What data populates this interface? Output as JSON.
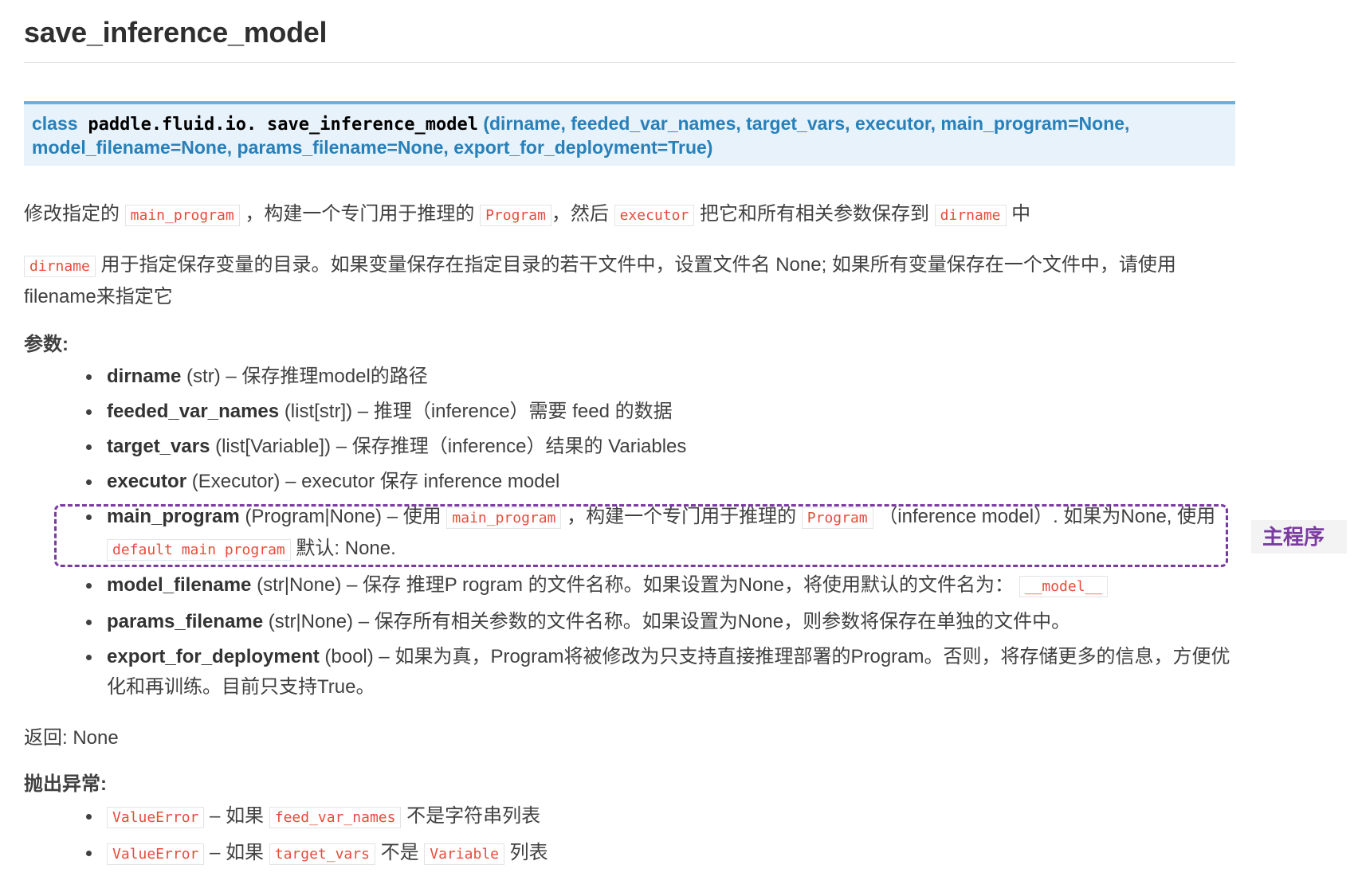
{
  "title": "save_inference_model",
  "signature": {
    "class_kw": "class",
    "module": "paddle.fluid.io.",
    "func": "save_inference_model",
    "args_line1": "(dirname, feeded_var_names, target_vars, executor, main_program=None,",
    "args_line2": "model_filename=None, params_filename=None, export_for_deployment=True)"
  },
  "desc1": {
    "t1": "修改指定的",
    "c1": "main_program",
    "t2": "，构建一个专门用于推理的",
    "c2": "Program",
    "t3": "，然后",
    "c3": "executor",
    "t4": "把它和所有相关参数保存到",
    "c4": "dirname",
    "t5": "中"
  },
  "desc2": {
    "c1": "dirname",
    "t1": "用于指定保存变量的目录。如果变量保存在指定目录的若干文件中，设置文件名 None; 如果所有变量保存在一个文件中，请使用filename来指定它"
  },
  "params_label": "参数:",
  "params": [
    {
      "name": "dirname",
      "type": "(str)",
      "sep": "–",
      "desc": "保存推理model的路径"
    },
    {
      "name": "feeded_var_names",
      "type": "(list[str])",
      "sep": "–",
      "desc": "推理（inference）需要 feed 的数据"
    },
    {
      "name": "target_vars",
      "type": "(list[Variable])",
      "sep": "–",
      "desc": "保存推理（inference）结果的 Variables"
    },
    {
      "name": "executor",
      "type": "(Executor)",
      "sep": "–",
      "desc": "executor 保存 inference model"
    },
    {
      "name": "main_program",
      "type": "(Program|None)",
      "sep": "–",
      "d1": "使用",
      "c1": "main_program",
      "d2": "，构建一个专门用于推理的",
      "c2": "Program",
      "d3": "（inference model）. 如果为None, 使用",
      "c3": "default main program",
      "d4": "默认: None."
    },
    {
      "name": "model_filename",
      "type": "(str|None)",
      "sep": "–",
      "d1": "保存 推理P rogram 的文件名称。如果设置为None，将使用默认的文件名为：",
      "c1": "__model__"
    },
    {
      "name": "params_filename",
      "type": "(str|None)",
      "sep": "–",
      "desc": "保存所有相关参数的文件名称。如果设置为None，则参数将保存在单独的文件中。"
    },
    {
      "name": "export_for_deployment",
      "type": "(bool)",
      "sep": "–",
      "desc": "如果为真，Program将被修改为只支持直接推理部署的Program。否则，将存储更多的信息，方便优化和再训练。目前只支持True。"
    }
  ],
  "returns": "返回: None",
  "raises_label": "抛出异常:",
  "raises": [
    {
      "c1": "ValueError",
      "t1": "– 如果",
      "c2": "feed_var_names",
      "t2": "不是字符串列表"
    },
    {
      "c1": "ValueError",
      "t1": "– 如果",
      "c2": "target_vars",
      "t2": "不是",
      "c3": "Variable",
      "t3": "列表"
    }
  ],
  "annotation": "主程序",
  "colors": {
    "accent": "#2980b9",
    "literal": "#e74c3c",
    "highlight": "#7a3ba0"
  }
}
